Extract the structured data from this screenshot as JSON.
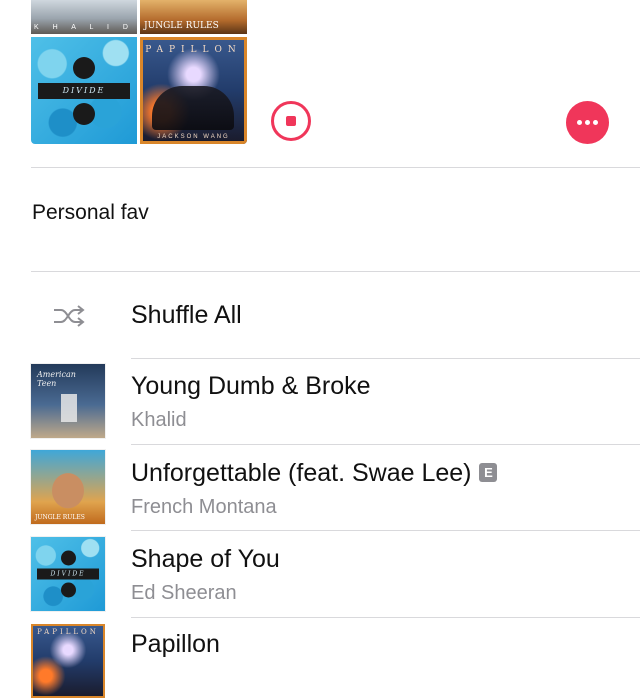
{
  "artwork": {
    "tiles": [
      {
        "name": "khalid",
        "text": "K H A L I D"
      },
      {
        "name": "jungle-rules",
        "text": "JUNGLE RULES"
      },
      {
        "name": "divide",
        "text": "DIVIDE"
      },
      {
        "name": "papillon",
        "text": "PAPILLON",
        "subtext": "JACKSON WANG"
      }
    ]
  },
  "controls": {
    "stop_icon": "stop-circle-icon",
    "more_icon": "ellipsis-icon"
  },
  "playlist": {
    "description": "Personal fav"
  },
  "shuffle": {
    "label": "Shuffle All",
    "icon": "shuffle-icon"
  },
  "songs": [
    {
      "title": "Young Dumb & Broke",
      "artist": "Khalid",
      "explicit": false,
      "art_text": "American Teen"
    },
    {
      "title": "Unforgettable (feat. Swae Lee)",
      "artist": "French Montana",
      "explicit": true,
      "explicit_label": "E",
      "art_text": "JUNGLE RULES"
    },
    {
      "title": "Shape of You",
      "artist": "Ed Sheeran",
      "explicit": false,
      "art_text": "DIVIDE"
    },
    {
      "title": "Papillon",
      "artist": "",
      "explicit": false,
      "art_text": "PAPILLON"
    }
  ],
  "colors": {
    "accent": "#f0365a",
    "secondary_text": "#8e8e93",
    "divider": "#d9d9dc"
  }
}
